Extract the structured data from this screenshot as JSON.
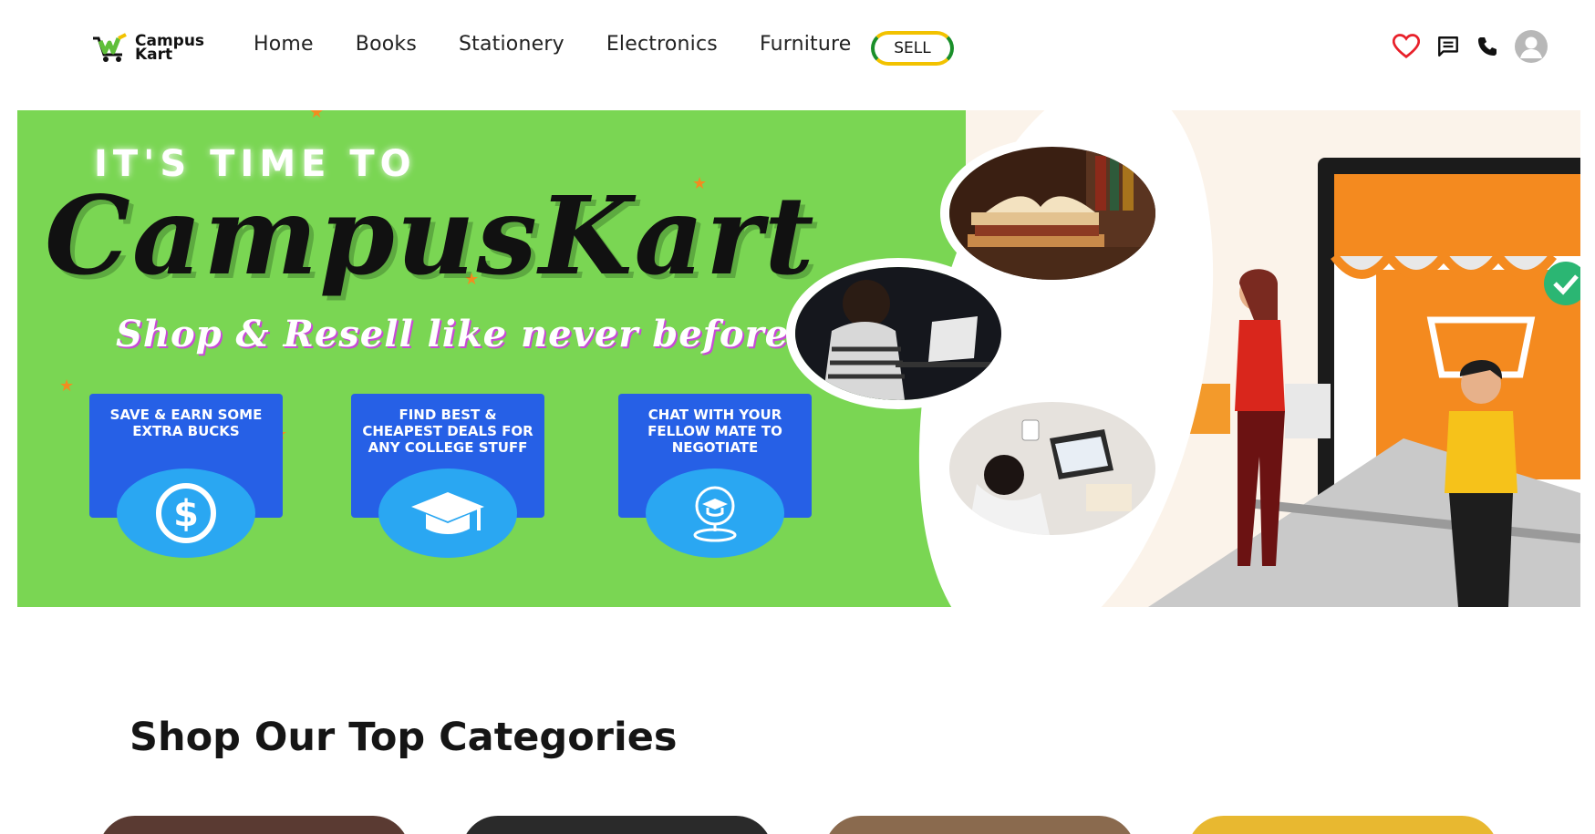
{
  "header": {
    "logo": {
      "line1": "Campus",
      "line2": "Kart",
      "icon": "cart-logo-icon"
    },
    "nav": [
      {
        "label": "Home"
      },
      {
        "label": "Books"
      },
      {
        "label": "Stationery"
      },
      {
        "label": "Electronics"
      },
      {
        "label": "Furniture"
      }
    ],
    "sell_label": "SELL",
    "icons": [
      "heart-icon",
      "chat-icon",
      "phone-icon",
      "avatar-icon"
    ]
  },
  "banner": {
    "tagline": "IT'S TIME TO",
    "brand": "CampusKart",
    "subline": "Shop & Resell like never before...",
    "features": [
      {
        "text": "SAVE & EARN SOME EXTRA BUCKS",
        "icon": "dollar-icon"
      },
      {
        "text": "FIND BEST & CHEAPEST DEALS FOR ANY COLLEGE STUFF",
        "icon": "graduation-cap-icon"
      },
      {
        "text": "CHAT WITH YOUR FELLOW MATE TO NEGOTIATE",
        "icon": "location-cap-icon"
      }
    ]
  },
  "categories": {
    "title": "Shop Our Top Categories"
  },
  "colors": {
    "banner_green": "#7ad653",
    "feature_blue": "#2660e6",
    "heart_red": "#e8202a",
    "sell_yellow": "#f2c200",
    "sell_green": "#1a8f2a"
  }
}
